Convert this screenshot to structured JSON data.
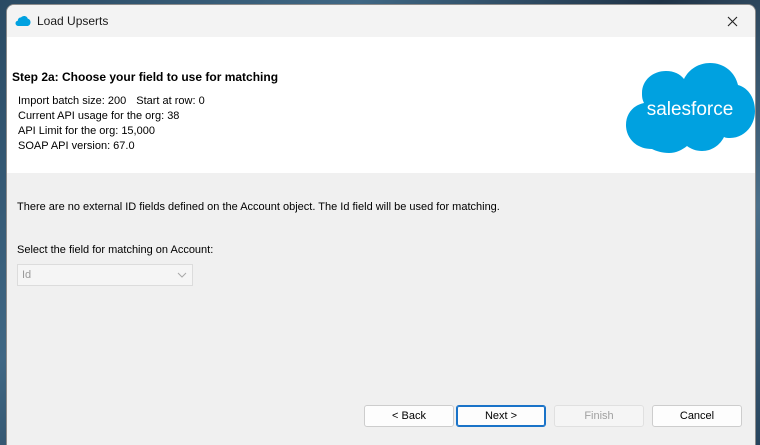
{
  "window": {
    "title": "Load Upserts",
    "icon": "salesforce-cloud-icon",
    "close_icon": "close-icon"
  },
  "header": {
    "step_title": "Step 2a: Choose your field to use for matching",
    "batch_size": "Import batch size: 200",
    "start_row": "Start at row: 0",
    "api_usage": "Current API usage for the org: 38",
    "api_limit": "API Limit for the org: 15,000",
    "soap_version": "SOAP API version: 67.0",
    "logo_text": "salesforce"
  },
  "main": {
    "info_message": "There are no external ID fields defined on the Account object. The Id field will be used for matching.",
    "select_label": "Select the field for matching on Account:",
    "select_value": "Id"
  },
  "buttons": {
    "back": "< Back",
    "next": "Next >",
    "finish": "Finish",
    "cancel": "Cancel"
  },
  "colors": {
    "brand": "#00a1e0",
    "focus": "#1a73c8"
  }
}
